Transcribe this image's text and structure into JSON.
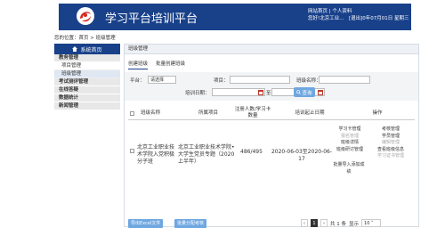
{
  "header": {
    "title": "学习平台培训平台",
    "links": [
      "网站首页",
      "个人资料"
    ],
    "user_line": "您好!北京工业...",
    "date_line": "[退出]0年07月01日 星期三"
  },
  "breadcrumb": "您的位置：首页 > 班级管理",
  "sidebar": {
    "head_label": "系统首页",
    "groups": [
      {
        "label": "教务管理",
        "items": [
          "项目管理",
          "班级管理"
        ]
      },
      {
        "label": "考试测评管理",
        "items": []
      },
      {
        "label": "在线答疑",
        "items": []
      },
      {
        "label": "数据统计",
        "items": []
      },
      {
        "label": "新闻管理",
        "items": []
      }
    ]
  },
  "main": {
    "panel_title": "班级管理",
    "tabs": [
      "创建班级",
      "批量创建班级"
    ],
    "filter": {
      "platform_label": "平台：",
      "platform_value": "请选择",
      "project_label": "项目：",
      "class_name_label": "班级名称：",
      "train_date_label": "培训日期：",
      "to_label": "至",
      "search_label": "查询"
    },
    "table": {
      "headers": [
        "班级名称",
        "所属项目",
        "注册人数/学习卡数量",
        "培训起止日期",
        "操作"
      ],
      "row": {
        "name": "北京工业职业技术学院入党积极分子班",
        "project": "北京工业职业技术学院•大学生党员专题（2020上半年）",
        "count": "486/495",
        "dates": "2020-06-03至2020-06-17",
        "ops_left": [
          {
            "label": "学习卡管理",
            "enabled": true
          },
          {
            "label": "报名管理",
            "enabled": false
          },
          {
            "label": "班级详情",
            "enabled": true
          },
          {
            "label": "班级研讨管理",
            "enabled": true
          },
          {
            "label": "批量导入添加成绩",
            "enabled": true
          }
        ],
        "ops_right": [
          {
            "label": "考核管理",
            "enabled": true
          },
          {
            "label": "学员管理",
            "enabled": true
          },
          {
            "label": "编辑管理",
            "enabled": false
          },
          {
            "label": "查看班级信息",
            "enabled": true
          },
          {
            "label": "学习证书管理",
            "enabled": false
          }
        ]
      }
    },
    "footer": {
      "export_label": "导出Excel文件",
      "batch_label": "批量分配考核",
      "current_page": "1",
      "total_label": "共 1 条",
      "show_label": "显示",
      "page_size": "10"
    }
  },
  "colors": {
    "brand": "#19418a",
    "button": "#6fa7e0"
  }
}
